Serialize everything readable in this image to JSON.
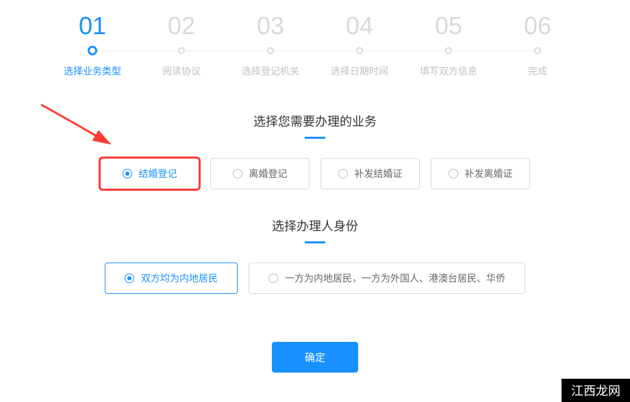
{
  "steps": [
    {
      "num": "01",
      "label": "选择业务类型",
      "active": true
    },
    {
      "num": "02",
      "label": "阅读协议",
      "active": false
    },
    {
      "num": "03",
      "label": "选择登记机关",
      "active": false
    },
    {
      "num": "04",
      "label": "选择日期时间",
      "active": false
    },
    {
      "num": "05",
      "label": "填写双方信息",
      "active": false
    },
    {
      "num": "06",
      "label": "完成",
      "active": false
    }
  ],
  "section1": {
    "title": "选择您需要办理的业务",
    "options": [
      {
        "label": "结婚登记",
        "selected": true,
        "highlighted": true
      },
      {
        "label": "离婚登记",
        "selected": false,
        "highlighted": false
      },
      {
        "label": "补发结婚证",
        "selected": false,
        "highlighted": false
      },
      {
        "label": "补发离婚证",
        "selected": false,
        "highlighted": false
      }
    ]
  },
  "section2": {
    "title": "选择办理人身份",
    "options": [
      {
        "label": "双方均为内地居民",
        "selected": true
      },
      {
        "label": "一方为内地居民，一方为外国人、港澳台居民、华侨",
        "selected": false
      }
    ]
  },
  "confirm_label": "确定",
  "watermark": "江西龙网",
  "colors": {
    "primary": "#1890ff",
    "highlight": "#ff3b30",
    "muted": "#d9d9d9"
  }
}
